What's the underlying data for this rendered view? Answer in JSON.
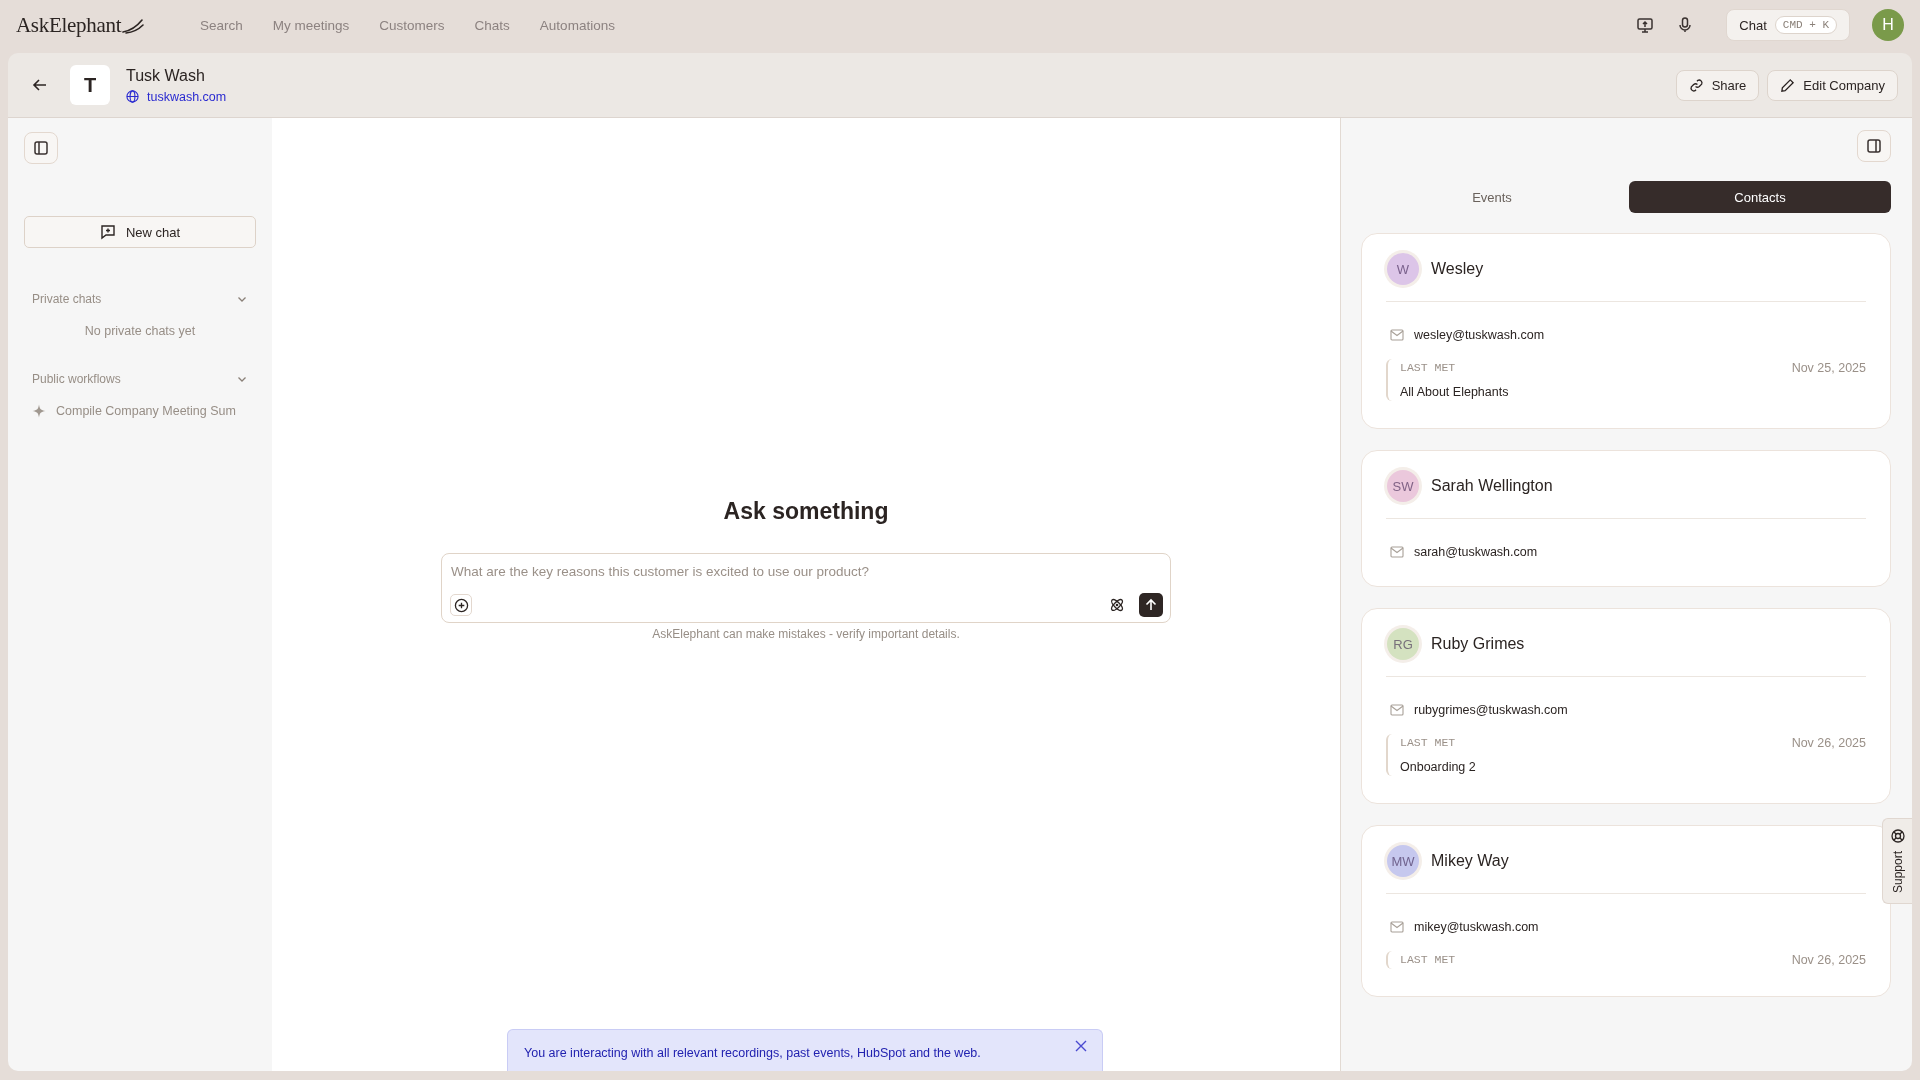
{
  "app": {
    "logo": "AskElephant"
  },
  "nav": [
    "Search",
    "My meetings",
    "Customers",
    "Chats",
    "Automations"
  ],
  "topbar": {
    "chat_button": "Chat",
    "shortcut": "CMD + K",
    "user_initial": "H"
  },
  "company": {
    "initial": "T",
    "name": "Tusk Wash",
    "website": "tuskwash.com",
    "actions": [
      "Share",
      "Edit Company"
    ]
  },
  "sidebar": {
    "new_chat": "New chat",
    "sections": [
      {
        "title": "Private chats",
        "expanded": true,
        "empty_text": "No private chats yet"
      },
      {
        "title": "Public workflows",
        "expanded": true,
        "items": [
          "Compile Company Meeting Sum"
        ]
      }
    ]
  },
  "chat": {
    "heading": "Ask something",
    "placeholder": "What are the key reasons this customer is excited to use our product?",
    "disclaimer": "AskElephant can make mistakes - verify important details."
  },
  "banner": {
    "text": "You are interacting with all relevant recordings, past events, HubSpot and the web."
  },
  "panel": {
    "tabs": [
      {
        "label": "Events",
        "selected": false
      },
      {
        "label": "Contacts",
        "selected": true
      }
    ],
    "contacts": [
      {
        "initials": "W",
        "name": "Wesley",
        "color": "#dcc5e8",
        "email": "wesley@tuskwash.com",
        "last_met_label": "LAST MET",
        "last_met_date": "Nov 25, 2025",
        "last_met_event": "All About Elephants"
      },
      {
        "initials": "SW",
        "name": "Sarah Wellington",
        "color": "#ebc8dc",
        "email": "sarah@tuskwash.com"
      },
      {
        "initials": "RG",
        "name": "Ruby Grimes",
        "color": "#d4e2c0",
        "email": "rubygrimes@tuskwash.com",
        "last_met_label": "LAST MET",
        "last_met_date": "Nov 26, 2025",
        "last_met_event": "Onboarding 2"
      },
      {
        "initials": "MW",
        "name": "Mikey Way",
        "color": "#c6c8ee",
        "email": "mikey@tuskwash.com",
        "last_met_label": "LAST MET",
        "last_met_date": "Nov 26, 2025"
      }
    ]
  },
  "support_tab": "Support"
}
